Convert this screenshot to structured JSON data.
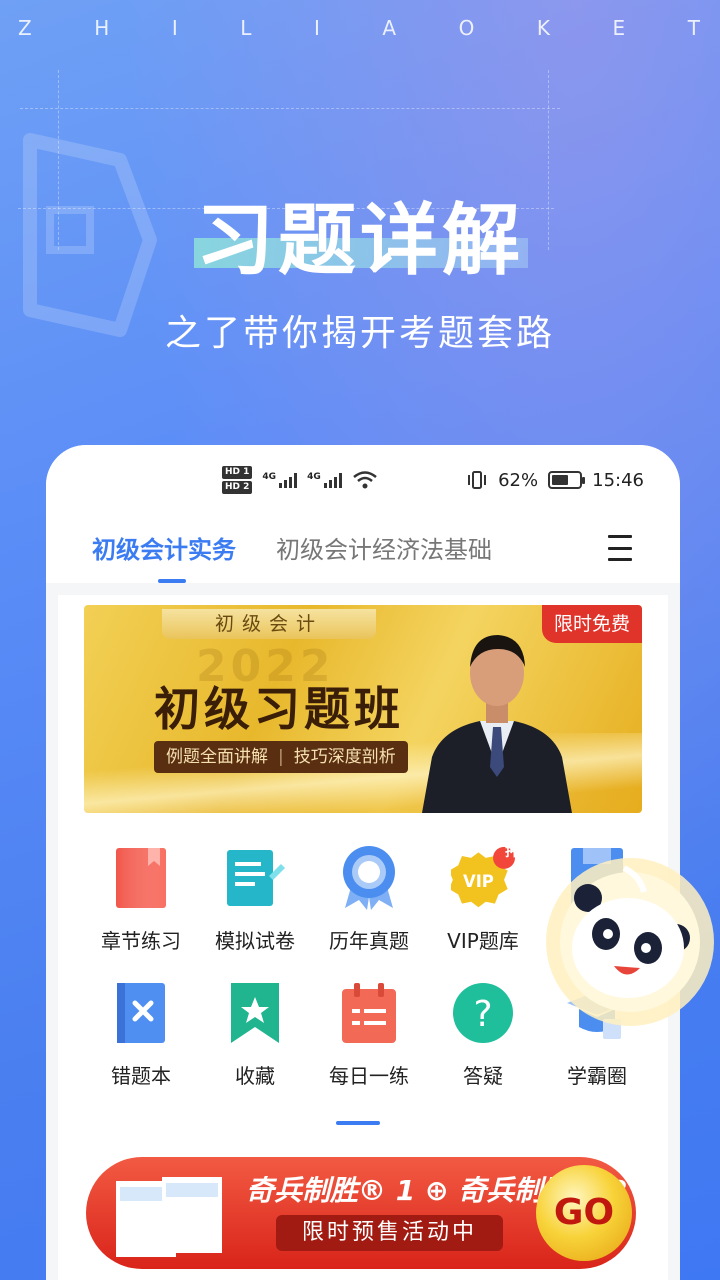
{
  "brand_letters": [
    "Z",
    "H",
    "I",
    "L",
    "I",
    "A",
    "O",
    "K",
    "E",
    "T"
  ],
  "headline": "习题详解",
  "subline": "之了带你揭开考题套路",
  "status_bar": {
    "hd1": "HD 1",
    "hd2": "HD 2",
    "net1": "4G",
    "net2": "4G",
    "battery_percent": "62%",
    "battery_level": 0.62,
    "time": "15:46"
  },
  "tabs": [
    {
      "label": "初级会计实务",
      "active": true
    },
    {
      "label": "初级会计经济法基础",
      "active": false
    }
  ],
  "banner": {
    "tag": "初级会计",
    "year": "2022",
    "title": "初级习题班",
    "pill_left": "例题全面讲解",
    "pill_sep": "|",
    "pill_right": "技巧深度剖析",
    "badge": "限时免费"
  },
  "grid": [
    {
      "label": "章节练习",
      "icon": "book-icon"
    },
    {
      "label": "模拟试卷",
      "icon": "exam-paper-icon"
    },
    {
      "label": "历年真题",
      "icon": "medal-icon"
    },
    {
      "label": "VIP题库",
      "icon": "vip-icon",
      "badge": "押"
    },
    {
      "label": "",
      "icon": "notebook-icon"
    },
    {
      "label": "错题本",
      "icon": "wrong-notebook-icon"
    },
    {
      "label": "收藏",
      "icon": "bookmark-star-icon"
    },
    {
      "label": "每日一练",
      "icon": "calendar-icon"
    },
    {
      "label": "答疑",
      "icon": "question-icon"
    },
    {
      "label": "学霸圈",
      "icon": "graduation-cap-icon"
    }
  ],
  "promo": {
    "line1": "奇兵制胜® 1 ⊕ 奇兵制胜® 2",
    "line2": "限时预售活动中",
    "go": "GO"
  },
  "colors": {
    "accent": "#3b7cf2",
    "banner_gold": "#e8b82c",
    "promo_red": "#d9241a"
  }
}
